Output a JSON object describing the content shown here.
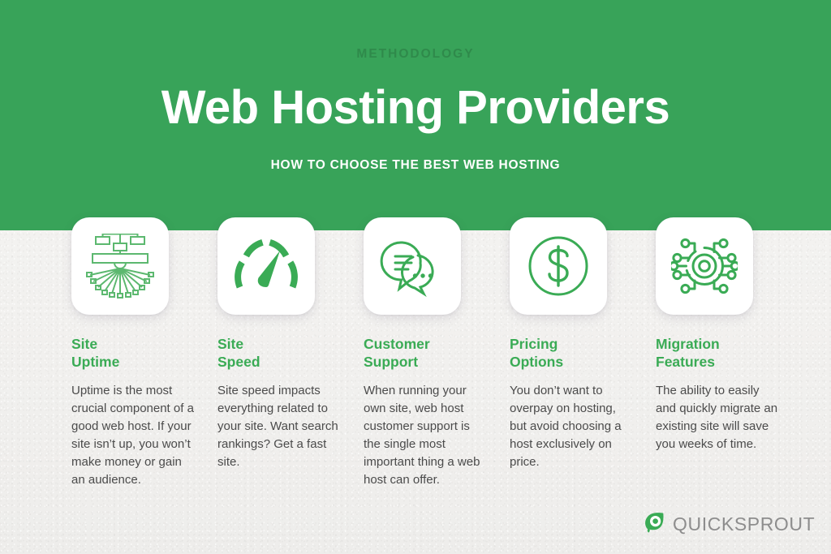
{
  "header": {
    "kicker": "METHODOLOGY",
    "title": "Web Hosting Providers",
    "subtitle": "HOW TO CHOOSE THE BEST WEB HOSTING",
    "band_color": "#38a359",
    "kicker_color": "#2f8a4b"
  },
  "theme": {
    "accent_green": "#3aab55",
    "body_text": "#4b4b4b",
    "page_background": "#f2f1ef",
    "card_background": "#ffffff"
  },
  "columns": [
    {
      "icon": "server-uptime-network-icon",
      "title": "Site\nUptime",
      "body": "Uptime is the most crucial component of a good web host. If your site isn’t up, you won’t make money or gain an audience."
    },
    {
      "icon": "speedometer-gauge-icon",
      "title": "Site\nSpeed",
      "body": "Site speed impacts everything related to your site. Want search rankings? Get a fast site."
    },
    {
      "icon": "chat-bubbles-support-icon",
      "title": "Customer\nSupport",
      "body": "When running your own site, web host customer support is the single most important thing a web host can offer."
    },
    {
      "icon": "dollar-coin-icon",
      "title": "Pricing\nOptions",
      "body": "You don’t want to overpay on hosting, but avoid choosing a host exclusively on price."
    },
    {
      "icon": "circuit-hub-migration-icon",
      "title": "Migration\nFeatures",
      "body": "The ability to easily and quickly migrate an existing site will save you weeks of time."
    }
  ],
  "logo": {
    "mark": "quicksprout-sprout-mark-icon",
    "wordmark": "QUICKSPROUT",
    "mark_color": "#3aab55",
    "word_color": "#8d8d8d"
  }
}
